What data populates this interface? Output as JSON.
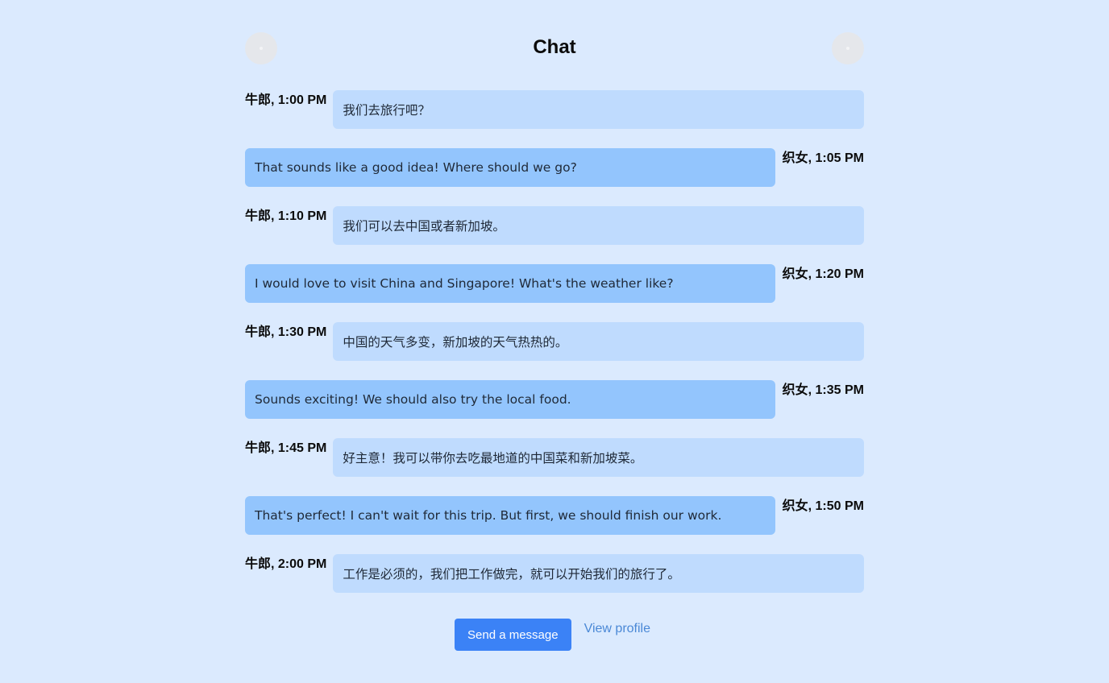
{
  "header": {
    "title": "Chat",
    "left_avatar_icon": "user-avatar-icon",
    "right_avatar_icon": "user-avatar-icon"
  },
  "messages": [
    {
      "side": "left",
      "meta": "牛郎, 1:00 PM",
      "text": "我们去旅行吧？"
    },
    {
      "side": "right",
      "meta": "织女, 1:05 PM",
      "text": "That sounds like a good idea! Where should we go?"
    },
    {
      "side": "left",
      "meta": "牛郎, 1:10 PM",
      "text": "我们可以去中国或者新加坡。"
    },
    {
      "side": "right",
      "meta": "织女, 1:20 PM",
      "text": "I would love to visit China and Singapore! What's the weather like?"
    },
    {
      "side": "left",
      "meta": "牛郎, 1:30 PM",
      "text": "中国的天气多变，新加坡的天气热热的。"
    },
    {
      "side": "right",
      "meta": "织女, 1:35 PM",
      "text": "Sounds exciting! We should also try the local food."
    },
    {
      "side": "left",
      "meta": "牛郎, 1:45 PM",
      "text": "好主意！我可以带你去吃最地道的中国菜和新加坡菜。"
    },
    {
      "side": "right",
      "meta": "织女, 1:50 PM",
      "text": "That's perfect! I can't wait for this trip. But first, we should finish our work."
    },
    {
      "side": "left",
      "meta": "牛郎, 2:00 PM",
      "text": "工作是必须的，我们把工作做完，就可以开始我们的旅行了。"
    }
  ],
  "actions": {
    "send_label": "Send a message",
    "profile_label": "View profile"
  },
  "colors": {
    "background": "#dbeafe",
    "bubble_left": "#bfdbfe",
    "bubble_right": "#93c5fd",
    "accent": "#3b82f6",
    "link": "#4a88d6"
  }
}
